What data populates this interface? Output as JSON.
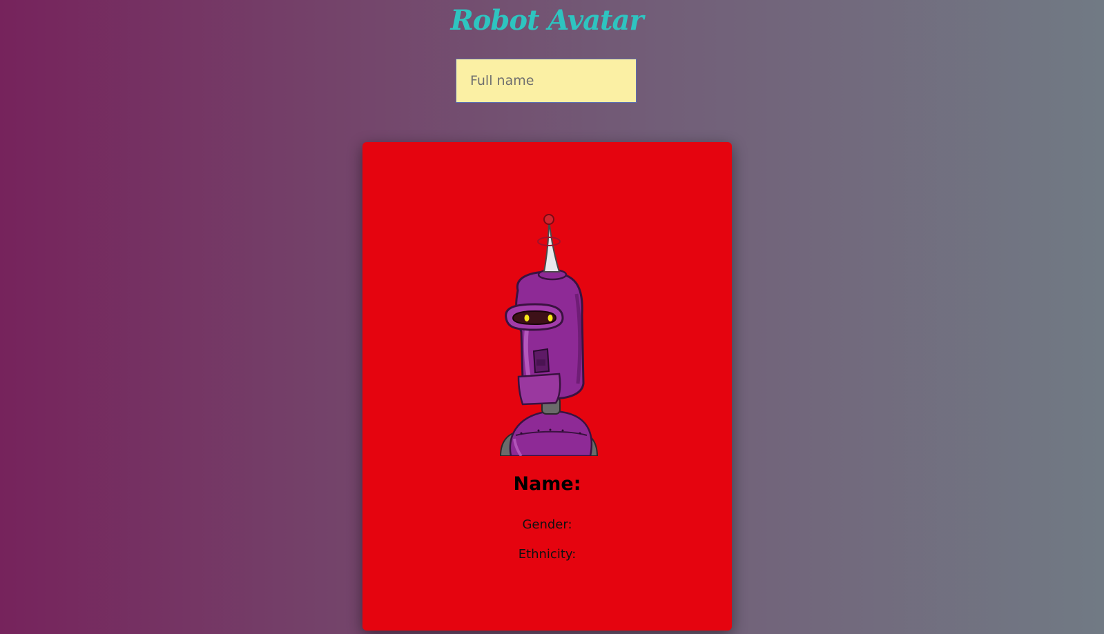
{
  "header": {
    "title": "Robot Avatar"
  },
  "form": {
    "name_placeholder": "Full name",
    "name_value": ""
  },
  "card": {
    "name_label": "Name:",
    "gender_label": "Gender:",
    "ethnicity_label": "Ethnicity:",
    "background_color": "#e5040f",
    "avatar_icon": "purple-robot-avatar"
  },
  "colors": {
    "title": "#2ec4c0",
    "input_background": "#fbf0a4",
    "robot_body": "#8e2a96"
  }
}
